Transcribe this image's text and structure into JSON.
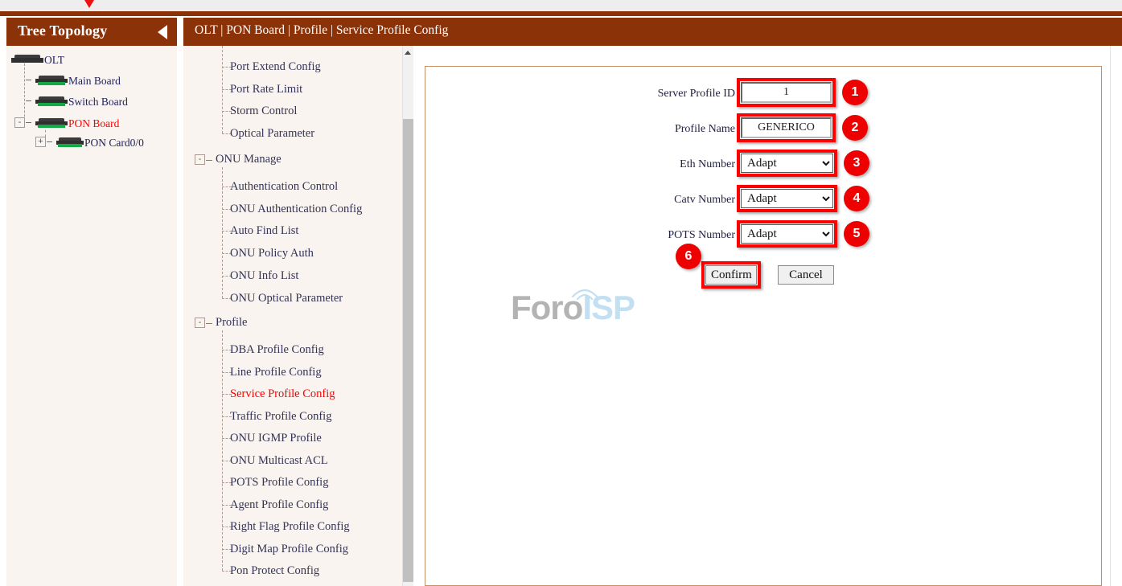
{
  "topbar": {
    "marker_icon": "red-down-triangle"
  },
  "tree_panel": {
    "title": "Tree Topology",
    "collapse_icon": "triangle-left-icon",
    "nodes": [
      {
        "label": "OLT",
        "depth": 0,
        "icon": "device-flat-icon",
        "red": false,
        "toggle": ""
      },
      {
        "label": "Main Board",
        "depth": 1,
        "icon": "device-icon",
        "red": false,
        "toggle": ""
      },
      {
        "label": "Switch Board",
        "depth": 1,
        "icon": "device-icon",
        "red": false,
        "toggle": ""
      },
      {
        "label": "PON Board",
        "depth": 1,
        "icon": "device-icon",
        "red": true,
        "toggle": "-"
      },
      {
        "label": "PON Card0/0",
        "depth": 2,
        "icon": "device-icon",
        "red": false,
        "toggle": "+"
      }
    ]
  },
  "header": {
    "breadcrumb": "OLT | PON Board | Profile | Service Profile Config"
  },
  "menu": {
    "items": [
      {
        "label": "Port Extend Config",
        "type": "leaf",
        "active": false
      },
      {
        "label": "Port Rate Limit",
        "type": "leaf",
        "active": false
      },
      {
        "label": "Storm Control",
        "type": "leaf",
        "active": false
      },
      {
        "label": "Optical Parameter",
        "type": "leaf",
        "active": false,
        "last": true
      },
      {
        "label": "ONU Manage",
        "type": "group",
        "active": false,
        "toggle": "-"
      },
      {
        "label": "Authentication Control",
        "type": "leaf",
        "active": false
      },
      {
        "label": "ONU Authentication Config",
        "type": "leaf",
        "active": false
      },
      {
        "label": "Auto Find List",
        "type": "leaf",
        "active": false
      },
      {
        "label": "ONU Policy Auth",
        "type": "leaf",
        "active": false
      },
      {
        "label": "ONU Info List",
        "type": "leaf",
        "active": false
      },
      {
        "label": "ONU Optical Parameter",
        "type": "leaf",
        "active": false,
        "last": true
      },
      {
        "label": "Profile",
        "type": "group",
        "active": false,
        "toggle": "-"
      },
      {
        "label": "DBA Profile Config",
        "type": "leaf",
        "active": false
      },
      {
        "label": "Line Profile Config",
        "type": "leaf",
        "active": false
      },
      {
        "label": "Service Profile Config",
        "type": "leaf",
        "active": true
      },
      {
        "label": "Traffic Profile Config",
        "type": "leaf",
        "active": false
      },
      {
        "label": "ONU IGMP Profile",
        "type": "leaf",
        "active": false
      },
      {
        "label": "ONU Multicast ACL",
        "type": "leaf",
        "active": false
      },
      {
        "label": "POTS Profile Config",
        "type": "leaf",
        "active": false
      },
      {
        "label": "Agent Profile Config",
        "type": "leaf",
        "active": false
      },
      {
        "label": "Right Flag Profile Config",
        "type": "leaf",
        "active": false
      },
      {
        "label": "Digit Map Profile Config",
        "type": "leaf",
        "active": false
      },
      {
        "label": "Pon Protect Config",
        "type": "leaf",
        "active": false,
        "last": true
      }
    ],
    "scrollbar": {
      "up_icon": "arrow-up-icon"
    }
  },
  "form": {
    "fields": [
      {
        "label": "Server Profile ID",
        "colon": ":",
        "kind": "text",
        "value": "1",
        "badge": "1"
      },
      {
        "label": "Profile Name",
        "colon": ":",
        "kind": "text",
        "value": "GENERICO",
        "badge": "2"
      },
      {
        "label": "Eth Number",
        "colon": ":",
        "kind": "select",
        "value": "Adapt",
        "badge": "3"
      },
      {
        "label": "Catv Number",
        "colon": ":",
        "kind": "select",
        "value": "Adapt",
        "badge": "4"
      },
      {
        "label": "POTS Number",
        "colon": ":",
        "kind": "select",
        "value": "Adapt",
        "badge": "5"
      }
    ],
    "select_options": [
      "Adapt"
    ],
    "confirm_label": "Confirm",
    "cancel_label": "Cancel",
    "confirm_badge": "6"
  },
  "watermark": {
    "part1": "Foro",
    "part2": "ISP"
  },
  "colors": {
    "brand_brown": "#8c3208",
    "panel_bg": "#faf4f0",
    "accent_red": "#ff0000",
    "badge_red": "#ee0000",
    "active_link": "#ff0000",
    "panel_border": "#c58f68"
  }
}
